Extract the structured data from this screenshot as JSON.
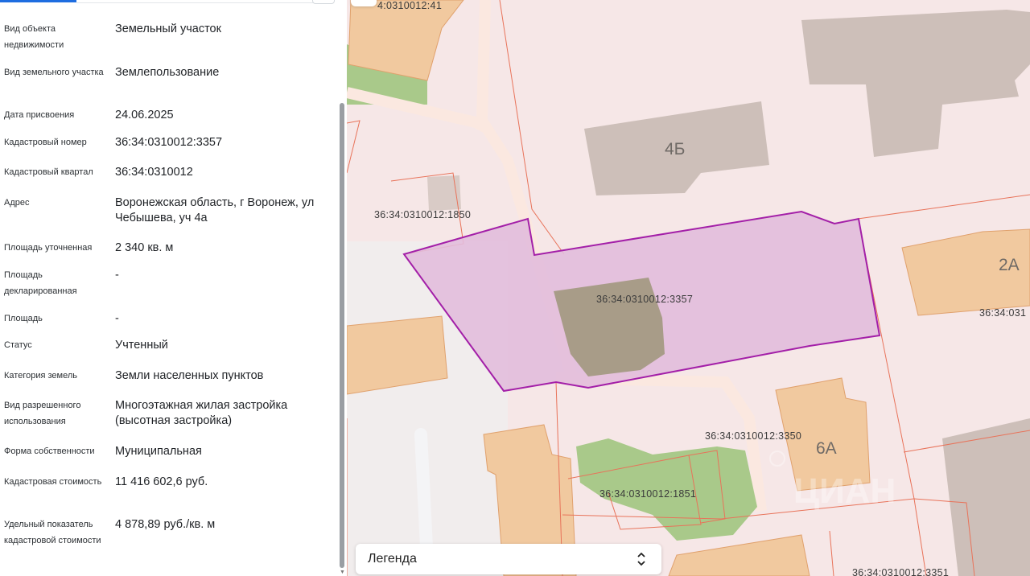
{
  "properties": [
    {
      "label": "Вид объекта недвижимости",
      "value": "Земельный участок"
    },
    {
      "label": "Вид земельного участка",
      "value": "Землепользование"
    },
    {
      "label": "Дата присвоения",
      "value": "24.06.2025"
    },
    {
      "label": "Кадастровый номер",
      "value": "36:34:0310012:3357"
    },
    {
      "label": "Кадастровый квартал",
      "value": "36:34:0310012"
    },
    {
      "label": "Адрес",
      "value": "Воронежская область, г Воронеж, ул Чебышева, уч 4а"
    },
    {
      "label": "Площадь уточненная",
      "value": "2 340 кв. м"
    },
    {
      "label": "Площадь декларированная",
      "value": "-"
    },
    {
      "label": "Площадь",
      "value": "-"
    },
    {
      "label": "Статус",
      "value": "Учтенный"
    },
    {
      "label": "Категория земель",
      "value": "Земли населенных пунктов"
    },
    {
      "label": "Вид разрешенного использования",
      "value": "Многоэтажная жилая застройка (высотная застройка)"
    },
    {
      "label": "Форма собственности",
      "value": "Муниципальная"
    },
    {
      "label": "Кадастровая стоимость",
      "value": "11 416 602,6 руб."
    },
    {
      "label": "Удельный показатель кадастровой стоимости",
      "value": "4 878,89 руб./кв. м"
    }
  ],
  "map": {
    "parcel_labels": {
      "top": "4:0310012:41",
      "p1850": "36:34:0310012:1850",
      "selected": "36:34:0310012:3357",
      "p3350": "36:34:0310012:3350",
      "p1851": "36:34:0310012:1851",
      "right": "36:34:031",
      "p3351": "36:34:0310012:3351"
    },
    "building_labels": {
      "b4b": "4Б",
      "b2a": "2А",
      "b6a": "6А"
    },
    "watermark": "ЦИАН",
    "colors": {
      "selected_fill": "#e2bddc",
      "selected_stroke": "#a31fa8",
      "parcel_stroke": "#e8735a",
      "building_gray": "#cdbfb9",
      "building_orange": "#f1c99f",
      "green": "#a9c98a"
    }
  },
  "legend": {
    "label": "Легенда",
    "icon": "chevron-up-down-icon"
  }
}
